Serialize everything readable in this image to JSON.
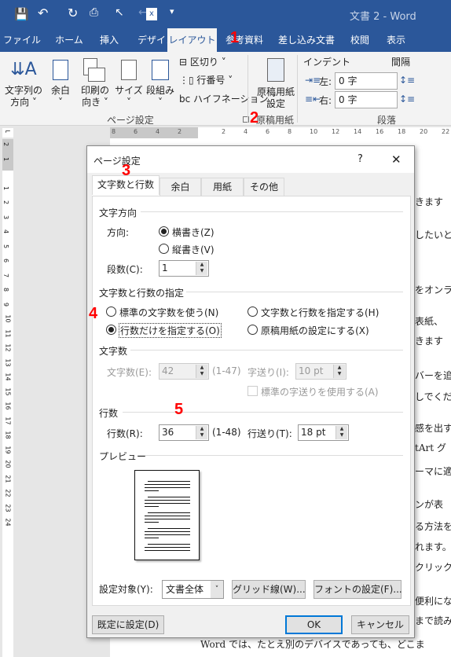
{
  "titlebar": {
    "title": "文書 2 - Word",
    "qat": [
      "save-icon",
      "undo-icon",
      "redo-icon",
      "print-preview-icon",
      "pointer-icon",
      "back-icon",
      "excel-icon",
      "customize-icon"
    ]
  },
  "tabs": [
    "ファイル",
    "ホーム",
    "挿入",
    "デザイン",
    "レイアウト",
    "参考資料",
    "差し込み文書",
    "校閲",
    "表示"
  ],
  "active_tab": "レイアウト",
  "ribbon": {
    "text_direction": [
      "文字列の",
      "方向 ˅"
    ],
    "margins": [
      "余白",
      "˅"
    ],
    "orientation": [
      "印刷の",
      "向き ˅"
    ],
    "size": [
      "サイズ",
      "˅"
    ],
    "columns": [
      "段組み",
      "˅"
    ],
    "breaks": "区切り ˅",
    "line_numbers": "行番号 ˅",
    "hyphenation": "ハイフネーション ˅",
    "page_setup_group": "ページ設定",
    "genko": [
      "原稿用紙",
      "設定"
    ],
    "genko_group": "原稿用紙",
    "indent": "インデント",
    "spacing": "間隔",
    "left_label": "左:",
    "left_value": "0 字",
    "right_label": "右:",
    "right_value": "0 字",
    "paragraph_group": "段落"
  },
  "ruler": {
    "h": [
      "8",
      "6",
      "4",
      "2",
      "",
      "2",
      "4",
      "6",
      "8",
      "10",
      "12",
      "14",
      "16",
      "18",
      "20",
      "22"
    ],
    "v": [
      "2",
      "1",
      "",
      "1",
      "2",
      "3",
      "4",
      "5",
      "6",
      "7",
      "8",
      "9",
      "10",
      "11",
      "12",
      "13",
      "14",
      "15",
      "16",
      "17",
      "18",
      "19",
      "20",
      "21",
      "22",
      "23",
      "24"
    ]
  },
  "document_lines": [
    "きます",
    "したいと",
    "をオンラ",
    "表紙、",
    "きます",
    "バーを追",
    "しでくだ",
    "感を出す",
    "tArt グ",
    "ーマに適",
    "ンが表",
    "る方法を",
    "れます。",
    "クリック",
    "便利にな",
    "まで読み",
    "Word では、たとえ別のデバイスであっても、どこま"
  ],
  "annotations": [
    "1",
    "2",
    "3",
    "4",
    "5"
  ],
  "dialog": {
    "title": "ページ設定",
    "help": "?",
    "close": "✕",
    "tabs": [
      "文字数と行数",
      "余白",
      "用紙",
      "その他"
    ],
    "text_dir_section": "文字方向",
    "direction_label": "方向:",
    "horizontal": "横書き(Z)",
    "vertical": "縦書き(V)",
    "columns_label": "段数(C):",
    "columns_value": "1",
    "grid_section": "文字数と行数の指定",
    "opt_standard": "標準の文字数を使う(N)",
    "opt_chars_lines": "文字数と行数を指定する(H)",
    "opt_lines_only": "行数だけを指定する(O)",
    "opt_genko": "原稿用紙の設定にする(X)",
    "selected_option": "行数だけを指定する(O)",
    "chars_section": "文字数",
    "chars_label": "文字数(E):",
    "chars_value": "42",
    "chars_range": "(1-47)",
    "pitch_label": "字送り(I):",
    "pitch_value": "10 pt",
    "std_pitch": "標準の字送りを使用する(A)",
    "lines_section": "行数",
    "lines_label": "行数(R):",
    "lines_value": "36",
    "lines_range": "(1-48)",
    "line_pitch_label": "行送り(T):",
    "line_pitch_value": "18 pt",
    "preview_section": "プレビュー",
    "apply_label": "設定対象(Y):",
    "apply_value": "文書全体",
    "grid_button": "グリッド線(W)...",
    "font_button": "フォントの設定(F)...",
    "default_button": "既定に設定(D)",
    "ok": "OK",
    "cancel": "キャンセル"
  },
  "colors": {
    "accent": "#2b579a",
    "annotation": "#ff0000",
    "ok_border": "#0078d7"
  }
}
